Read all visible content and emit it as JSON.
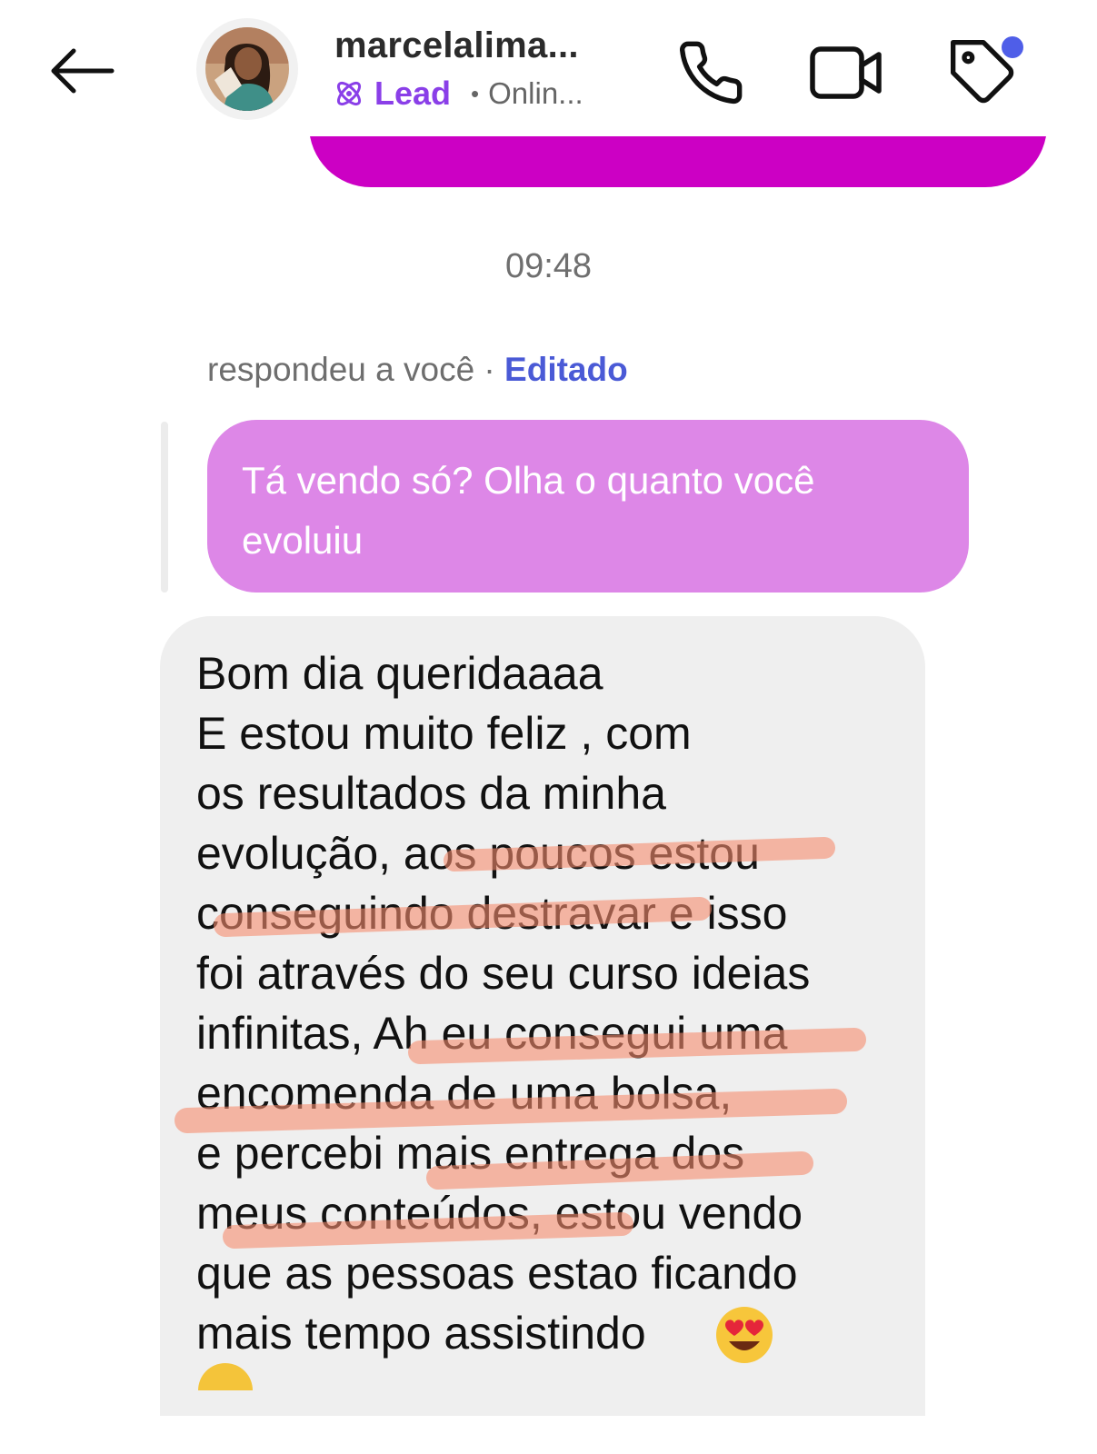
{
  "header": {
    "contact_name": "marcelalima...",
    "lead_label": "Lead",
    "online_dot": "•",
    "online_status": "Onlin...",
    "icons": {
      "back": "back-arrow-icon",
      "lead": "lead-atom-icon",
      "call": "phone-icon",
      "video": "video-camera-icon",
      "tag": "tag-icon"
    },
    "notification_color": "#4f5ee8"
  },
  "chat": {
    "timestamp": "09:48",
    "reply_meta": "respondeu a você · ",
    "reply_edited": "Editado",
    "quoted_message": "Tá vendo só? Olha o quanto você evoluiu",
    "message": "Bom dia queridaaaa\nE estou muito feliz , com\nos resultados da minha\nevolução, aos poucos estou\nconseguindo destravar e isso\nfoi através do seu curso ideias\ninfinitas, Ah eu consegui uma\nencomenda de uma bolsa,\ne percebi mais entrega dos\nmeus conteúdos, estou vendo\nque as pessoas estao ficando\nmais tempo assistindo",
    "emoji": "heart-eyes-emoji-icon"
  },
  "colors": {
    "sent_bubble": "#cc00c4",
    "quoted_bubble": "#dd87e7",
    "received_bubble": "#efefef",
    "highlight": "#f58c6e",
    "lead_purple": "#8a3fe8",
    "edited_blue": "#4a5ad6"
  }
}
